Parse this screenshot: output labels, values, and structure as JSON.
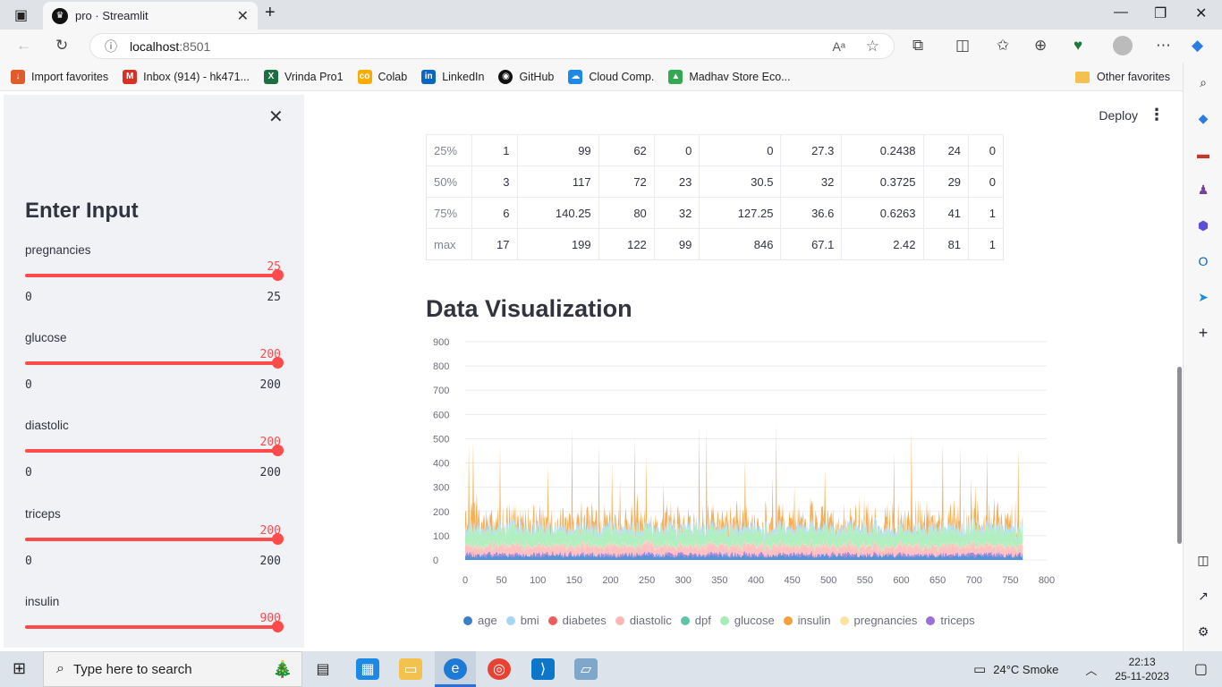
{
  "browser": {
    "tab_title": "pro · Streamlit",
    "tab_close": "✕",
    "url_host": "localhost",
    "url_port": ":8501",
    "favorites": [
      {
        "label": "Import favorites",
        "icon": "import-icon",
        "color": "#e25b2b"
      },
      {
        "label": "Inbox (914) - hk471...",
        "icon": "gmail-icon",
        "color": "#d93025"
      },
      {
        "label": "Vrinda Pro1",
        "icon": "excel-icon",
        "color": "#1d6f42"
      },
      {
        "label": "Colab",
        "icon": "colab-icon",
        "color": "#f9ab00"
      },
      {
        "label": "LinkedIn",
        "icon": "linkedin-icon",
        "color": "#0a66c2"
      },
      {
        "label": "GitHub",
        "icon": "github-icon",
        "color": "#111111"
      },
      {
        "label": "Cloud Comp.",
        "icon": "cloud-icon",
        "color": "#1e88e5"
      },
      {
        "label": "Madhav Store Eco...",
        "icon": "drive-icon",
        "color": "#34a853"
      }
    ],
    "other_favorites": "Other favorites"
  },
  "app": {
    "deploy_label": "Deploy",
    "menu_glyph": "⋮"
  },
  "sidebar": {
    "close_glyph": "✕",
    "title": "Enter Input",
    "sliders": [
      {
        "label": "pregnancies",
        "value": "25",
        "min": "0",
        "max": "25"
      },
      {
        "label": "glucose",
        "value": "200",
        "min": "0",
        "max": "200"
      },
      {
        "label": "diastolic",
        "value": "200",
        "min": "0",
        "max": "200"
      },
      {
        "label": "triceps",
        "value": "200",
        "min": "0",
        "max": "200"
      },
      {
        "label": "insulin",
        "value": "900",
        "min": "",
        "max": ""
      }
    ]
  },
  "stats_table": {
    "rows": [
      [
        "25%",
        "1",
        "99",
        "62",
        "0",
        "0",
        "27.3",
        "0.2438",
        "24",
        "0"
      ],
      [
        "50%",
        "3",
        "117",
        "72",
        "23",
        "30.5",
        "32",
        "0.3725",
        "29",
        "0"
      ],
      [
        "75%",
        "6",
        "140.25",
        "80",
        "32",
        "127.25",
        "36.6",
        "0.6263",
        "41",
        "1"
      ],
      [
        "max",
        "17",
        "199",
        "122",
        "99",
        "846",
        "67.1",
        "2.42",
        "81",
        "1"
      ]
    ]
  },
  "visualization": {
    "title": "Data Visualization"
  },
  "chart_data": {
    "type": "area",
    "title": "",
    "xlabel": "",
    "ylabel": "",
    "xlim": [
      0,
      800
    ],
    "ylim": [
      0,
      900
    ],
    "x_ticks": [
      "0",
      "50",
      "100",
      "150",
      "200",
      "250",
      "300",
      "350",
      "400",
      "450",
      "500",
      "550",
      "600",
      "650",
      "700",
      "750",
      "800"
    ],
    "y_ticks": [
      "0",
      "100",
      "200",
      "300",
      "400",
      "500",
      "600",
      "700",
      "800",
      "900"
    ],
    "grid": true,
    "legend_position": "bottom",
    "stacked": true,
    "x_points": 768,
    "series": [
      {
        "name": "age",
        "color": "#3d7ecb",
        "typical": 33,
        "max": 81
      },
      {
        "name": "bmi",
        "color": "#a6d5f7",
        "typical": 32,
        "max": 67
      },
      {
        "name": "diabetes",
        "color": "#f15b5b",
        "typical": 0.35,
        "max": 1
      },
      {
        "name": "diastolic",
        "color": "#ffb6b6",
        "typical": 69,
        "max": 122
      },
      {
        "name": "dpf",
        "color": "#5fc3a6",
        "typical": 0.47,
        "max": 2.42
      },
      {
        "name": "glucose",
        "color": "#a5ecb5",
        "typical": 121,
        "max": 199
      },
      {
        "name": "insulin",
        "color": "#f5a03a",
        "typical": 80,
        "max": 846
      },
      {
        "name": "pregnancies",
        "color": "#fde3a0",
        "typical": 4,
        "max": 17
      },
      {
        "name": "triceps",
        "color": "#9a6fd6",
        "typical": 21,
        "max": 99
      }
    ]
  },
  "taskbar": {
    "search_placeholder": "Type here to search",
    "weather": "24°C  Smoke",
    "time": "22:13",
    "date": "25-11-2023"
  }
}
